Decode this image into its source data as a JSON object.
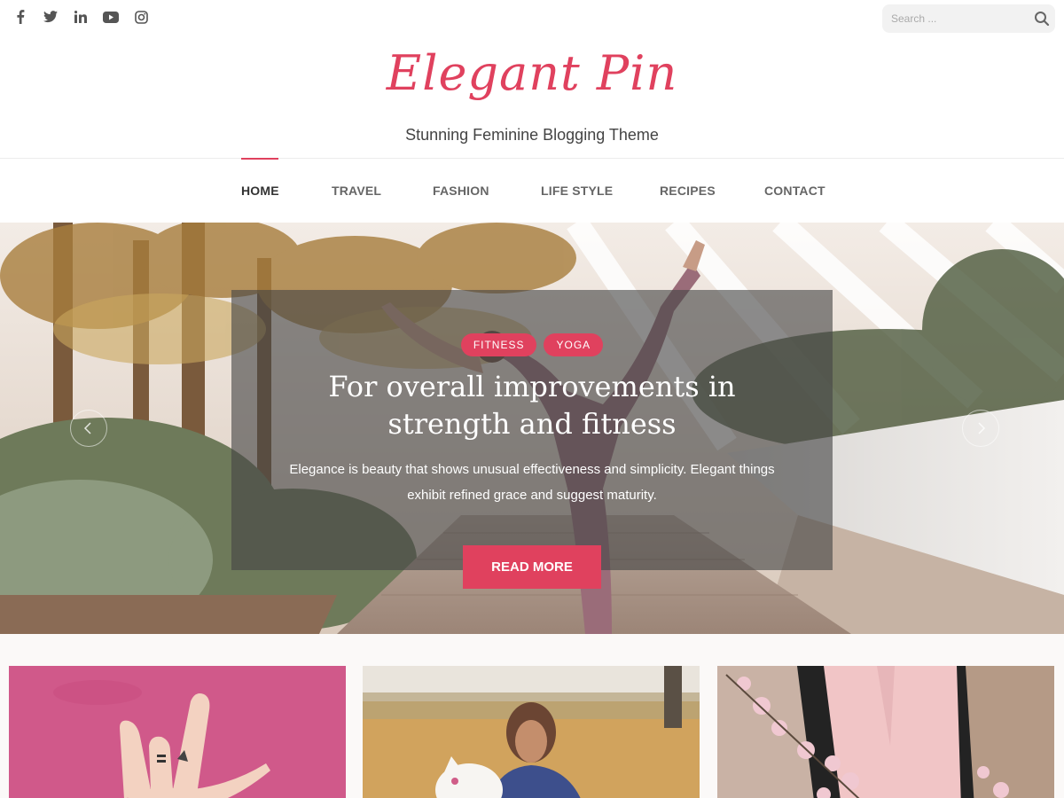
{
  "header": {
    "social_icons": [
      "facebook-icon",
      "twitter-icon",
      "linkedin-icon",
      "youtube-icon",
      "instagram-icon"
    ],
    "search": {
      "placeholder": "Search ..."
    }
  },
  "branding": {
    "site_title": "Elegant Pin",
    "tagline": "Stunning Feminine Blogging Theme"
  },
  "nav": {
    "items": [
      {
        "label": "HOME",
        "active": true
      },
      {
        "label": "TRAVEL",
        "active": false
      },
      {
        "label": "FASHION",
        "active": false
      },
      {
        "label": "LIFE STYLE",
        "active": false
      },
      {
        "label": "RECIPES",
        "active": false
      },
      {
        "label": "CONTACT",
        "active": false
      }
    ]
  },
  "hero": {
    "tags": [
      "FITNESS",
      "YOGA"
    ],
    "title": "For overall improvements in strength and fitness",
    "excerpt": "Elegance is beauty that shows unusual effectiveness and simplicity. Elegant things exhibit refined grace and suggest maturity.",
    "read_more": "READ MORE"
  },
  "cards": [
    {
      "image": "hand-on-pink-background"
    },
    {
      "image": "woman-with-dog-in-field"
    },
    {
      "image": "woman-with-blossoms"
    }
  ],
  "colors": {
    "accent": "#e0415e",
    "nav_text": "#666666",
    "nav_active": "#333333"
  }
}
